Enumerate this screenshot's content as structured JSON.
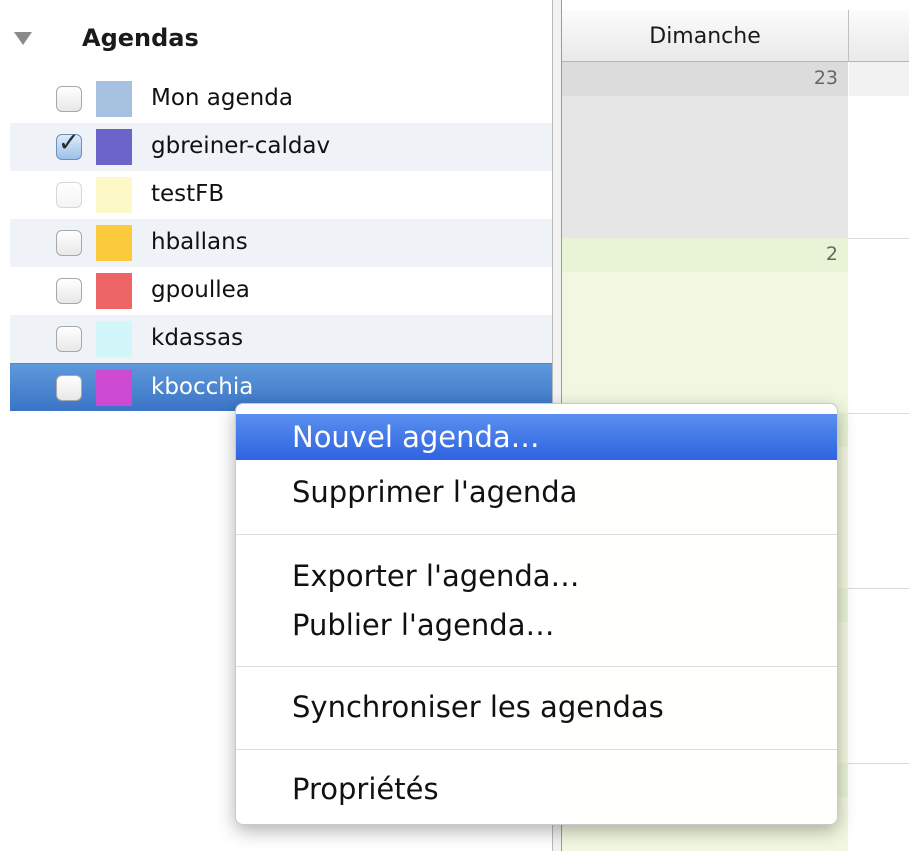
{
  "sidebar": {
    "title": "Agendas",
    "calendars": [
      {
        "label": "Mon agenda",
        "color": "#a7c1e0",
        "checked": false
      },
      {
        "label": "gbreiner-caldav",
        "color": "#6b64c9",
        "checked": true
      },
      {
        "label": "testFB",
        "color": "#fdf8c7",
        "checked": false
      },
      {
        "label": "hballans",
        "color": "#fbcb3d",
        "checked": false
      },
      {
        "label": "gpoullea",
        "color": "#ee6565",
        "checked": false
      },
      {
        "label": "kdassas",
        "color": "#d3f6fb",
        "checked": false
      },
      {
        "label": "kbocchia",
        "color": "#cd4bd2",
        "checked": false,
        "selected": true
      }
    ]
  },
  "calendar": {
    "day_header": "Dimanche",
    "day_numbers": [
      "23",
      "2"
    ],
    "colors": {
      "past_cell": "#e6e6e6",
      "current_month_cell": "#f2f8e0",
      "day_band_past": "#dcdcdc",
      "day_band_current": "#e9f3d6"
    }
  },
  "context_menu": {
    "items": [
      {
        "label": "Nouvel agenda…",
        "highlighted": true
      },
      {
        "label": "Supprimer l'agenda"
      },
      {
        "label": "Exporter l'agenda…"
      },
      {
        "label": "Publier l'agenda…"
      },
      {
        "label": "Synchroniser les agendas"
      },
      {
        "label": "Propriétés"
      }
    ]
  },
  "colors": {
    "selection": "#3b74c6",
    "menu_highlight": "#2f63e0",
    "checkmark": "#2a2a2a"
  }
}
